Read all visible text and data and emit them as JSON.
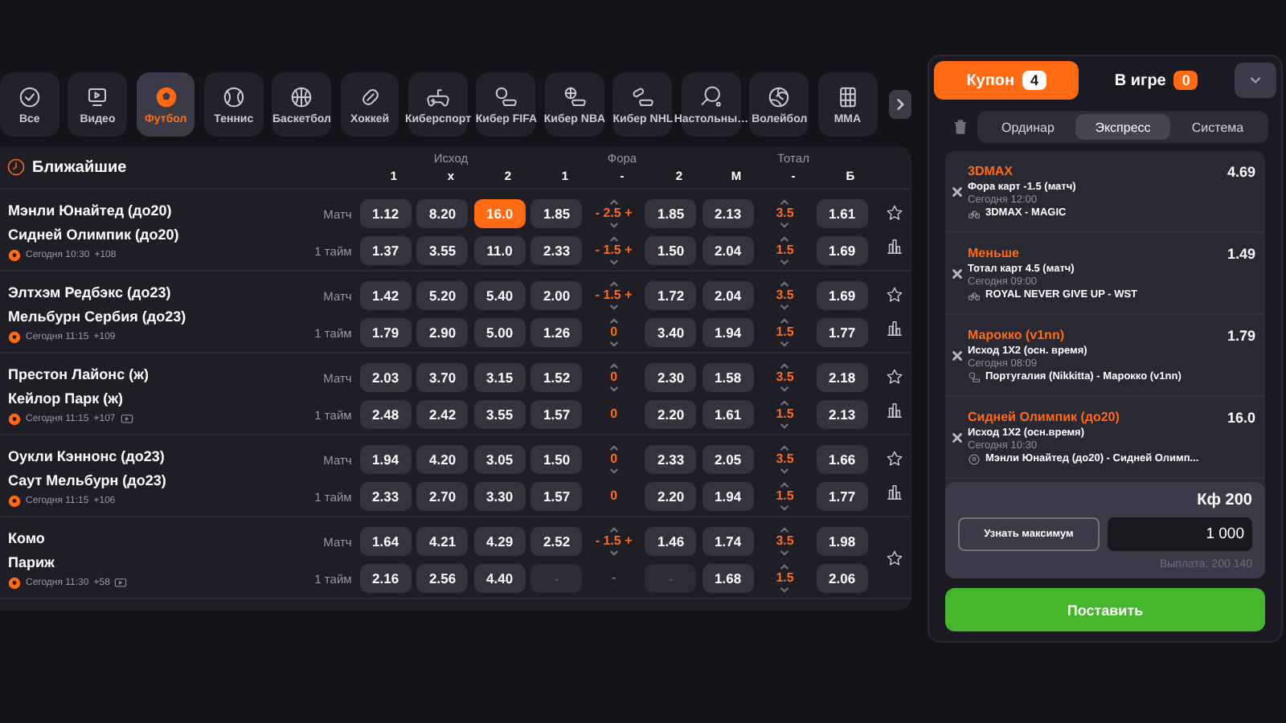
{
  "sports": [
    {
      "label": "Все",
      "kind": "all",
      "selected": false
    },
    {
      "label": "Видео",
      "kind": "video",
      "selected": false
    },
    {
      "label": "Футбол",
      "kind": "football",
      "selected": true
    },
    {
      "label": "Теннис",
      "kind": "tennis",
      "selected": false
    },
    {
      "label": "Баскетбол",
      "kind": "basketball",
      "selected": false
    },
    {
      "label": "Хоккей",
      "kind": "hockey",
      "selected": false
    },
    {
      "label": "Киберспорт",
      "kind": "gamepad",
      "selected": false
    },
    {
      "label": "Кибер FIFA",
      "kind": "cyberfootball",
      "selected": false
    },
    {
      "label": "Кибер NBA",
      "kind": "cyberbasketball",
      "selected": false
    },
    {
      "label": "Кибер NHL",
      "kind": "cyberhockey",
      "selected": false
    },
    {
      "label": "Настольны…",
      "kind": "pingpong",
      "selected": false
    },
    {
      "label": "Волейбол",
      "kind": "volleyball",
      "selected": false
    },
    {
      "label": "MMA",
      "kind": "mma",
      "selected": false
    }
  ],
  "events": {
    "title": "Ближайшие",
    "groups": [
      {
        "label": "Исход",
        "columns": [
          "1",
          "x",
          "2"
        ]
      },
      {
        "label": "Фора",
        "columns": [
          "1",
          "-",
          "2"
        ]
      },
      {
        "label": "Тотал",
        "columns": [
          "М",
          "-",
          "Б"
        ]
      }
    ],
    "matches": [
      {
        "home": "Мэнли Юнайтед (до20)",
        "away": "Сидней Олимпик (до20)",
        "time": "Сегодня 10:30",
        "markets": "+108",
        "video": false,
        "stats": true,
        "rows": [
          {
            "label": "Матч",
            "cells": [
              {
                "kind": "odd",
                "value": "1.12",
                "selected": false
              },
              {
                "kind": "odd",
                "value": "8.20",
                "selected": false
              },
              {
                "kind": "odd",
                "value": "16.0",
                "selected": true
              },
              {
                "kind": "odd",
                "value": "1.85",
                "selected": false
              },
              {
                "kind": "line",
                "value": "- 2.5 +",
                "arrows": true
              },
              {
                "kind": "odd",
                "value": "1.85",
                "selected": false
              },
              {
                "kind": "odd",
                "value": "2.13",
                "selected": false
              },
              {
                "kind": "line",
                "value": "3.5",
                "arrows": true
              },
              {
                "kind": "odd",
                "value": "1.61",
                "selected": false
              }
            ]
          },
          {
            "label": "1 тайм",
            "cells": [
              {
                "kind": "odd",
                "value": "1.37",
                "selected": false
              },
              {
                "kind": "odd",
                "value": "3.55",
                "selected": false
              },
              {
                "kind": "odd",
                "value": "11.0",
                "selected": false
              },
              {
                "kind": "odd",
                "value": "2.33",
                "selected": false
              },
              {
                "kind": "line",
                "value": "- 1.5 +",
                "arrows": true
              },
              {
                "kind": "odd",
                "value": "1.50",
                "selected": false
              },
              {
                "kind": "odd",
                "value": "2.04",
                "selected": false
              },
              {
                "kind": "line",
                "value": "1.5",
                "arrows": true
              },
              {
                "kind": "odd",
                "value": "1.69",
                "selected": false
              }
            ]
          }
        ]
      },
      {
        "home": "Элтхэм Редбэкс (до23)",
        "away": "Мельбурн Сербия (до23)",
        "time": "Сегодня 11:15",
        "markets": "+109",
        "video": false,
        "stats": true,
        "rows": [
          {
            "label": "Матч",
            "cells": [
              {
                "kind": "odd",
                "value": "1.42",
                "selected": false
              },
              {
                "kind": "odd",
                "value": "5.20",
                "selected": false
              },
              {
                "kind": "odd",
                "value": "5.40",
                "selected": false
              },
              {
                "kind": "odd",
                "value": "2.00",
                "selected": false
              },
              {
                "kind": "line",
                "value": "- 1.5 +",
                "arrows": true
              },
              {
                "kind": "odd",
                "value": "1.72",
                "selected": false
              },
              {
                "kind": "odd",
                "value": "2.04",
                "selected": false
              },
              {
                "kind": "line",
                "value": "3.5",
                "arrows": true
              },
              {
                "kind": "odd",
                "value": "1.69",
                "selected": false
              }
            ]
          },
          {
            "label": "1 тайм",
            "cells": [
              {
                "kind": "odd",
                "value": "1.79",
                "selected": false
              },
              {
                "kind": "odd",
                "value": "2.90",
                "selected": false
              },
              {
                "kind": "odd",
                "value": "5.00",
                "selected": false
              },
              {
                "kind": "odd",
                "value": "1.26",
                "selected": false
              },
              {
                "kind": "line",
                "value": "0",
                "arrows": true
              },
              {
                "kind": "odd",
                "value": "3.40",
                "selected": false
              },
              {
                "kind": "odd",
                "value": "1.94",
                "selected": false
              },
              {
                "kind": "line",
                "value": "1.5",
                "arrows": true
              },
              {
                "kind": "odd",
                "value": "1.77",
                "selected": false
              }
            ]
          }
        ]
      },
      {
        "home": "Престон Лайонс (ж)",
        "away": "Кейлор Парк (ж)",
        "time": "Сегодня 11:15",
        "markets": "+107",
        "video": true,
        "stats": true,
        "rows": [
          {
            "label": "Матч",
            "cells": [
              {
                "kind": "odd",
                "value": "2.03",
                "selected": false
              },
              {
                "kind": "odd",
                "value": "3.70",
                "selected": false
              },
              {
                "kind": "odd",
                "value": "3.15",
                "selected": false
              },
              {
                "kind": "odd",
                "value": "1.52",
                "selected": false
              },
              {
                "kind": "line",
                "value": "0",
                "arrows": true
              },
              {
                "kind": "odd",
                "value": "2.30",
                "selected": false
              },
              {
                "kind": "odd",
                "value": "1.58",
                "selected": false
              },
              {
                "kind": "line",
                "value": "3.5",
                "arrows": true
              },
              {
                "kind": "odd",
                "value": "2.18",
                "selected": false
              }
            ]
          },
          {
            "label": "1 тайм",
            "cells": [
              {
                "kind": "odd",
                "value": "2.48",
                "selected": false
              },
              {
                "kind": "odd",
                "value": "2.42",
                "selected": false
              },
              {
                "kind": "odd",
                "value": "3.55",
                "selected": false
              },
              {
                "kind": "odd",
                "value": "1.57",
                "selected": false
              },
              {
                "kind": "line",
                "value": "0",
                "arrows": false
              },
              {
                "kind": "odd",
                "value": "2.20",
                "selected": false
              },
              {
                "kind": "odd",
                "value": "1.61",
                "selected": false
              },
              {
                "kind": "line",
                "value": "1.5",
                "arrows": true
              },
              {
                "kind": "odd",
                "value": "2.13",
                "selected": false
              }
            ]
          }
        ]
      },
      {
        "home": "Оукли Кэннонс (до23)",
        "away": "Саут Мельбурн (до23)",
        "time": "Сегодня 11:15",
        "markets": "+106",
        "video": false,
        "stats": true,
        "rows": [
          {
            "label": "Матч",
            "cells": [
              {
                "kind": "odd",
                "value": "1.94",
                "selected": false
              },
              {
                "kind": "odd",
                "value": "4.20",
                "selected": false
              },
              {
                "kind": "odd",
                "value": "3.05",
                "selected": false
              },
              {
                "kind": "odd",
                "value": "1.50",
                "selected": false
              },
              {
                "kind": "line",
                "value": "0",
                "arrows": true
              },
              {
                "kind": "odd",
                "value": "2.33",
                "selected": false
              },
              {
                "kind": "odd",
                "value": "2.05",
                "selected": false
              },
              {
                "kind": "line",
                "value": "3.5",
                "arrows": true
              },
              {
                "kind": "odd",
                "value": "1.66",
                "selected": false
              }
            ]
          },
          {
            "label": "1 тайм",
            "cells": [
              {
                "kind": "odd",
                "value": "2.33",
                "selected": false
              },
              {
                "kind": "odd",
                "value": "2.70",
                "selected": false
              },
              {
                "kind": "odd",
                "value": "3.30",
                "selected": false
              },
              {
                "kind": "odd",
                "value": "1.57",
                "selected": false
              },
              {
                "kind": "line",
                "value": "0",
                "arrows": false
              },
              {
                "kind": "odd",
                "value": "2.20",
                "selected": false
              },
              {
                "kind": "odd",
                "value": "1.94",
                "selected": false
              },
              {
                "kind": "line",
                "value": "1.5",
                "arrows": true
              },
              {
                "kind": "odd",
                "value": "1.77",
                "selected": false
              }
            ]
          }
        ]
      },
      {
        "home": "Комо",
        "away": "Париж",
        "time": "Сегодня 11:30",
        "markets": "+58",
        "video": true,
        "stats": false,
        "rows": [
          {
            "label": "Матч",
            "cells": [
              {
                "kind": "odd",
                "value": "1.64",
                "selected": false
              },
              {
                "kind": "odd",
                "value": "4.21",
                "selected": false
              },
              {
                "kind": "odd",
                "value": "4.29",
                "selected": false
              },
              {
                "kind": "odd",
                "value": "2.52",
                "selected": false
              },
              {
                "kind": "line",
                "value": "- 1.5 +",
                "arrows": true
              },
              {
                "kind": "odd",
                "value": "1.46",
                "selected": false
              },
              {
                "kind": "odd",
                "value": "1.74",
                "selected": false
              },
              {
                "kind": "line",
                "value": "3.5",
                "arrows": true
              },
              {
                "kind": "odd",
                "value": "1.98",
                "selected": false
              }
            ]
          },
          {
            "label": "1 тайм",
            "cells": [
              {
                "kind": "odd",
                "value": "2.16",
                "selected": false
              },
              {
                "kind": "odd",
                "value": "2.56",
                "selected": false
              },
              {
                "kind": "odd",
                "value": "4.40",
                "selected": false
              },
              {
                "kind": "empty",
                "value": "-"
              },
              {
                "kind": "line",
                "value": "-",
                "arrows": false
              },
              {
                "kind": "empty",
                "value": "-"
              },
              {
                "kind": "odd",
                "value": "1.68",
                "selected": false
              },
              {
                "kind": "line",
                "value": "1.5",
                "arrows": true
              },
              {
                "kind": "odd",
                "value": "2.06",
                "selected": false
              }
            ]
          }
        ]
      }
    ]
  },
  "coupon": {
    "tabs": [
      {
        "label": "Купон",
        "count": "4",
        "selected": true
      },
      {
        "label": "В игре",
        "count": "0",
        "selected": false
      }
    ],
    "modes": [
      {
        "label": "Ординар",
        "selected": false
      },
      {
        "label": "Экспресс",
        "selected": true
      },
      {
        "label": "Система",
        "selected": false
      }
    ],
    "bets": [
      {
        "selection": "3DMAX",
        "odd": "4.69",
        "market": "Фора карт -1.5 (матч)",
        "time": "Сегодня 12:00",
        "event": "3DMAX - MAGIC",
        "kind": "cyber"
      },
      {
        "selection": "Меньше",
        "odd": "1.49",
        "market": "Тотал карт 4.5 (матч)",
        "time": "Сегодня 09:00",
        "event": "ROYAL NEVER GIVE UP - WST",
        "kind": "cyber"
      },
      {
        "selection": "Марокко (v1nn)",
        "odd": "1.79",
        "market": "Исход 1X2 (осн. время)",
        "time": "Сегодня 08:09",
        "event": "Португалия (Nikkitta) - Марокко (v1nn)",
        "kind": "cyberfootball"
      },
      {
        "selection": "Сидней Олимпик (до20)",
        "odd": "16.0",
        "market": "Исход 1X2 (осн.время)",
        "time": "Сегодня 10:30",
        "event": "Мэнли Юнайтед (до20) - Сидней Олимп...",
        "kind": "football"
      }
    ],
    "stake": {
      "coef_label": "Кф",
      "coef": "200",
      "max_button": "Узнать максимум",
      "amount": "1 000",
      "payout": "Выплата: 200 140"
    },
    "submit": "Поставить"
  }
}
